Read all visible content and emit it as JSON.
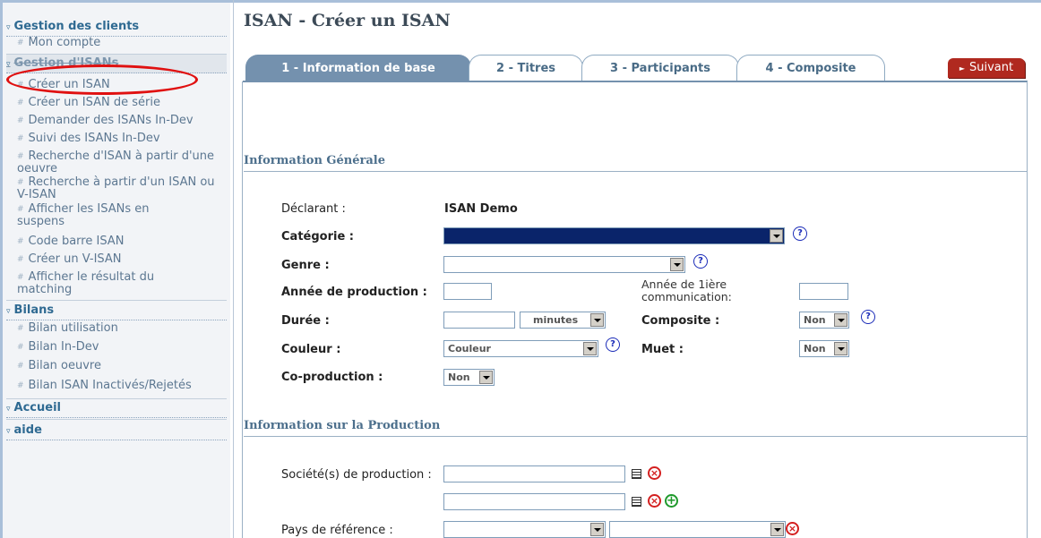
{
  "sidebar": {
    "clients": {
      "title": "Gestion des clients",
      "items": [
        "Mon compte"
      ]
    },
    "isan": {
      "title": "Gestion d'ISANs",
      "items": [
        "Créer un ISAN",
        "Créer un ISAN de série",
        "Demander des ISANs In-Dev",
        "Suivi des ISANs In-Dev",
        "Recherche d'ISAN à partir d'une oeuvre",
        "Recherche à partir d'un ISAN ou V-ISAN",
        "Afficher les ISANs en suspens",
        "Code barre ISAN",
        "Créer un V-ISAN",
        "Afficher le résultat du matching"
      ]
    },
    "bilans": {
      "title": "Bilans",
      "items": [
        "Bilan utilisation",
        "Bilan In-Dev",
        "Bilan oeuvre",
        "Bilan ISAN Inactivés/Rejetés"
      ]
    },
    "accueil": {
      "title": "Accueil"
    },
    "aide": {
      "title": "aide"
    }
  },
  "page": {
    "title": "ISAN - Créer un ISAN"
  },
  "tabs": [
    "1 - Information de base",
    "2 - Titres",
    "3 - Participants",
    "4 - Composite"
  ],
  "next_button": "Suivant",
  "general": {
    "title": "Information Générale",
    "declarant_label": "Déclarant :",
    "declarant_value": "ISAN Demo",
    "categorie_label": "Catégorie :",
    "genre_label": "Genre :",
    "annee_prod_label": "Année de production :",
    "annee_comm_label": "Année de 1ière communication:",
    "duree_label": "Durée :",
    "duree_unit": "minutes",
    "composite_label": "Composite :",
    "composite_value": "Non",
    "couleur_label": "Couleur :",
    "couleur_value": "Couleur",
    "muet_label": "Muet :",
    "muet_value": "Non",
    "coprod_label": "Co-production :",
    "coprod_value": "Non"
  },
  "production": {
    "title": "Information sur la Production",
    "societe_label": "Société(s) de production :",
    "pays_label": "Pays de référence :"
  },
  "icons": {
    "help": "?",
    "delete": "×",
    "add": "+"
  },
  "colors": {
    "accent": "#7491ae",
    "next": "#b0291f",
    "link": "#2f6a92"
  }
}
